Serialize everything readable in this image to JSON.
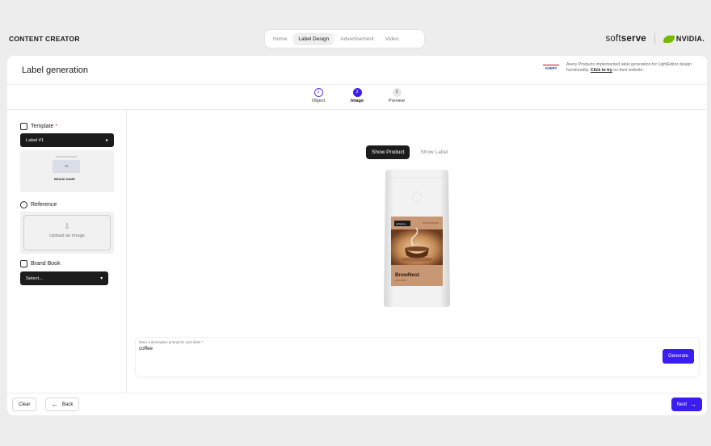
{
  "app": {
    "title": "CONTENT CREATOR"
  },
  "nav": {
    "items": [
      "Home",
      "Label Design",
      "Advertisement",
      "Video"
    ],
    "active": "Label Design"
  },
  "brand": {
    "softserve_light": "soft",
    "softserve_bold": "serve",
    "nvidia": "NVIDIA."
  },
  "page": {
    "title": "Label generation"
  },
  "avery": {
    "logo": "AVERY",
    "text_before": "Avery Products implemented label generation for LightEditor design functionality.",
    "link": "Click to try",
    "text_after": "on their website."
  },
  "steps": [
    {
      "num": "1",
      "label": "Object"
    },
    {
      "num": "2",
      "label": "Image"
    },
    {
      "num": "3",
      "label": "Preview"
    }
  ],
  "sidebar": {
    "template": {
      "label": "Template",
      "required": "*",
      "selected": "Label #1",
      "thumb_text": "AI",
      "thumb_brand": "BRAND NAME"
    },
    "reference": {
      "label": "Reference",
      "upload": "Upload an image"
    },
    "brand_book": {
      "label": "Brand Book",
      "select_placeholder": "Select..."
    }
  },
  "preview": {
    "toggle_active": "Show Product",
    "toggle_inactive": "Show Label",
    "label_brand": "softserve",
    "label_product": "BrewNest"
  },
  "prompt": {
    "label": "Enter a descriptive prompt for your label *",
    "value": "coffee",
    "generate": "Generate"
  },
  "footer": {
    "clear": "Clear",
    "back": "Back",
    "next": "Next"
  },
  "colors": {
    "accent": "#3a1df0",
    "dark": "#1c1c1c",
    "nvidia_green": "#76b900"
  }
}
